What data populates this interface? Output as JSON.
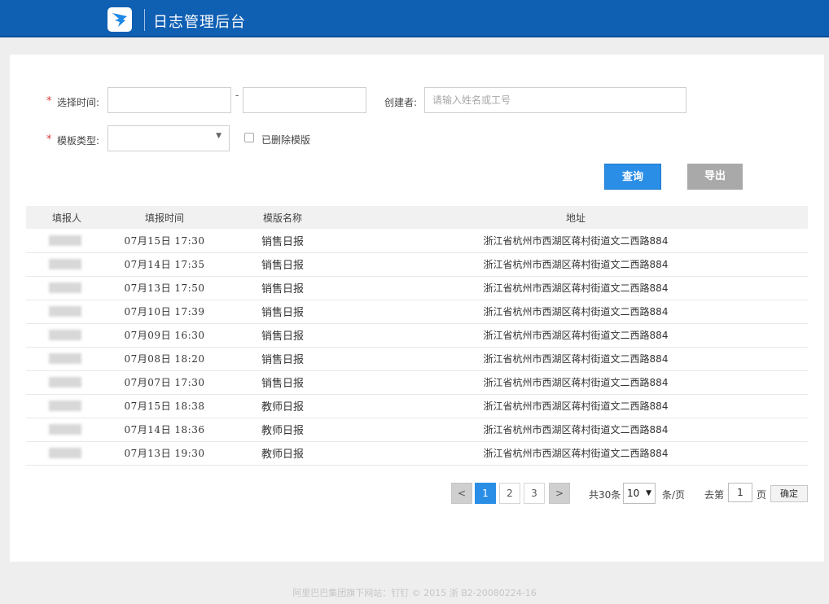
{
  "app": {
    "title": "日志管理后台",
    "brand_color": "#0f5fb3"
  },
  "filters": {
    "time_label": "选择时间:",
    "time_separator": "-",
    "start_value": "",
    "end_value": "",
    "creator_label": "创建者:",
    "creator_placeholder": "请输入姓名或工号",
    "template_label": "模板类型:",
    "template_value": "",
    "deleted_label": "已删除模版",
    "deleted_checked": false,
    "required_mark": "*"
  },
  "actions": {
    "query_label": "查询",
    "export_label": "导出"
  },
  "table": {
    "headers": [
      "填报人",
      "填报时间",
      "模版名称",
      "地址"
    ],
    "rows": [
      {
        "time": "07月15日  17:30",
        "template": "销售日报",
        "address": "浙江省杭州市西湖区蒋村街道文二西路884"
      },
      {
        "time": "07月14日  17:35",
        "template": "销售日报",
        "address": "浙江省杭州市西湖区蒋村街道文二西路884"
      },
      {
        "time": "07月13日  17:50",
        "template": "销售日报",
        "address": "浙江省杭州市西湖区蒋村街道文二西路884"
      },
      {
        "time": "07月10日  17:39",
        "template": "销售日报",
        "address": "浙江省杭州市西湖区蒋村街道文二西路884"
      },
      {
        "time": "07月09日  16:30",
        "template": "销售日报",
        "address": "浙江省杭州市西湖区蒋村街道文二西路884"
      },
      {
        "time": "07月08日  18:20",
        "template": "销售日报",
        "address": "浙江省杭州市西湖区蒋村街道文二西路884"
      },
      {
        "time": "07月07日  17:30",
        "template": "销售日报",
        "address": "浙江省杭州市西湖区蒋村街道文二西路884"
      },
      {
        "time": "07月15日  18:38",
        "template": "教师日报",
        "address": "浙江省杭州市西湖区蒋村街道文二西路884"
      },
      {
        "time": "07月14日  18:36",
        "template": "教师日报",
        "address": "浙江省杭州市西湖区蒋村街道文二西路884"
      },
      {
        "time": "07月13日  19:30",
        "template": "教师日报",
        "address": "浙江省杭州市西湖区蒋村街道文二西路884"
      }
    ]
  },
  "pagination": {
    "prev": "<",
    "pages": [
      "1",
      "2",
      "3"
    ],
    "current_page": "1",
    "next": ">",
    "total": "共30条",
    "page_size": "10",
    "per_page_label": "条/页",
    "goto_label": "去第",
    "goto_value": "1",
    "page_suffix": "页",
    "confirm_label": "确定"
  },
  "footer": {
    "text": "阿里巴巴集团旗下网站：钉钉 © 2015 浙 B2-20080224-16"
  }
}
